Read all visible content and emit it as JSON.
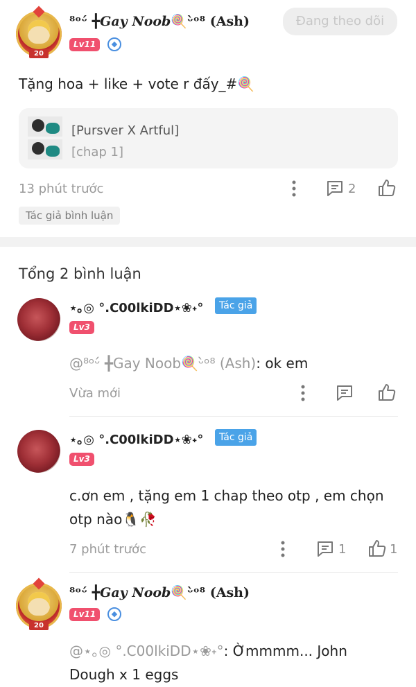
{
  "post": {
    "author": {
      "name_deco_left": "⁸ᵒᵕ́ ╋",
      "name_main": "Gay Noob",
      "name_emoji": "🍭",
      "name_deco_right": "ᵕ̀ᵒ⁸",
      "name_suffix": "(Ash)",
      "level": "Lv11",
      "avatar_ribbon": "20"
    },
    "follow_label": "Đang theo dõi",
    "text": "Tặng hoa + like + vote r đấy_#🍭",
    "ref": {
      "title": "[Pursver X Artful]",
      "subtitle": "[chap 1]"
    },
    "time": "13 phút trước",
    "comment_count": "2",
    "author_comment_tag": "Tác giả bình luận"
  },
  "comments_header": "Tổng 2 bình luận",
  "comments": [
    {
      "name": "⋆｡◎ °.C00lkiDD⋆❀˖°",
      "author_tag": "Tác giả",
      "level": "Lv3",
      "mention": "@⁸ᵒᵕ́ ╋Gay Noob🍭ᵕ̀ᵒ⁸ (Ash)",
      "text": ": ok em",
      "time": "Vừa mới"
    },
    {
      "name": "⋆｡◎ °.C00lkiDD⋆❀˖°",
      "author_tag": "Tác giả",
      "level": "Lv3",
      "text_line1": "c.ơn em , tặng em 1 chap theo otp , em chọn",
      "text_line2": "otp nào🐧🥀",
      "time": "7 phút trước",
      "reply_count": "1",
      "like_count": "1"
    },
    {
      "name_deco_left": "⁸ᵒᵕ́ ╋",
      "name_main": "Gay Noob",
      "name_emoji": "🍭",
      "name_deco_right": "ᵕ̀ᵒ⁸",
      "name_suffix": "(Ash)",
      "level": "Lv11",
      "avatar_ribbon": "20",
      "mention": "@⋆｡◎ °.C00lkiDD⋆❀˖°",
      "text_line1_rest": ": Ờmmmm... John",
      "text_line2": "Dough x 1 eggs"
    }
  ],
  "colors": {
    "level_badge": "#f0506e",
    "author_tag": "#4aa3e8",
    "verify": "#4a8fe0"
  }
}
